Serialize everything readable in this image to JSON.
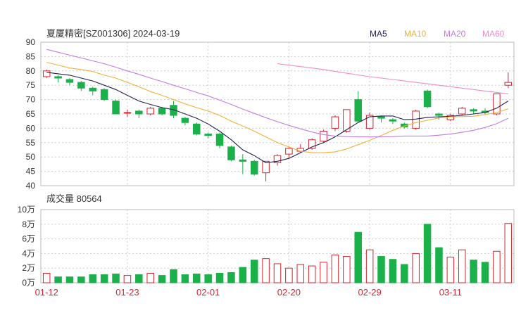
{
  "title": "夏厦精密[SZ001306] 2024-03-19",
  "legend": [
    {
      "label": "MA5",
      "color": "#1f2150"
    },
    {
      "label": "MA10",
      "color": "#f0b13c"
    },
    {
      "label": "MA20",
      "color": "#c07ee0"
    },
    {
      "label": "MA60",
      "color": "#f08cc8"
    }
  ],
  "colors": {
    "up": "#d4242f",
    "down": "#1ab04a",
    "grid": "#cccccc",
    "tick": "#333333",
    "date": "#d4242f"
  },
  "price_axis": {
    "ticks": [
      "90",
      "85",
      "80",
      "75",
      "70",
      "65",
      "60",
      "55",
      "50",
      "45",
      "40"
    ],
    "ylim": [
      40,
      90
    ]
  },
  "volume_axis": {
    "label": "成交量 80564",
    "ticks": [
      "10万",
      "8万",
      "6万",
      "4万",
      "2万",
      "0万"
    ],
    "ylim": [
      0,
      10
    ]
  },
  "x_axis": {
    "labels": [
      "01-12",
      "01-23",
      "02-01",
      "02-20",
      "02-29",
      "03-11"
    ],
    "label_index": [
      0,
      7,
      14,
      21,
      28,
      35
    ]
  },
  "chart_data": {
    "type": "candlestick",
    "title": "夏厦精密[SZ001306] 2024-03-19",
    "ohlc": [
      [
        78,
        80.5,
        77.5,
        80
      ],
      [
        78,
        78.5,
        76,
        77.5
      ],
      [
        77,
        77.5,
        75,
        76
      ],
      [
        76,
        76.5,
        73,
        74
      ],
      [
        74,
        74.5,
        71.5,
        73
      ],
      [
        73.5,
        74,
        69.5,
        70
      ],
      [
        69.5,
        70,
        65,
        65
      ],
      [
        65.5,
        66.5,
        64,
        65.5
      ],
      [
        66,
        66.5,
        63.5,
        65
      ],
      [
        65,
        67.5,
        64.5,
        67
      ],
      [
        67,
        67.5,
        64.5,
        65
      ],
      [
        68,
        69.5,
        63.5,
        64.5
      ],
      [
        63.5,
        64,
        61,
        62
      ],
      [
        61.5,
        62,
        57.5,
        58
      ],
      [
        58,
        58.5,
        56.5,
        57.5
      ],
      [
        58,
        58.5,
        53,
        54
      ],
      [
        53.5,
        54,
        48.5,
        49
      ],
      [
        49,
        51,
        44,
        48.5
      ],
      [
        48.5,
        49,
        43.5,
        44
      ],
      [
        44.5,
        48.5,
        41.5,
        48.5
      ],
      [
        48,
        51,
        47,
        50.5
      ],
      [
        51,
        53.5,
        49.5,
        53
      ],
      [
        52,
        54.5,
        51.5,
        53
      ],
      [
        53,
        56.5,
        52.5,
        56
      ],
      [
        55.5,
        59.5,
        55,
        59
      ],
      [
        60,
        64.5,
        59,
        64
      ],
      [
        59,
        66.5,
        58.5,
        66.5
      ],
      [
        70,
        73,
        62,
        62.5
      ],
      [
        60,
        65.5,
        59.5,
        64.5
      ],
      [
        64,
        64.5,
        62,
        63.5
      ],
      [
        63,
        63.5,
        61.5,
        62.5
      ],
      [
        61.5,
        62,
        60,
        60.5
      ],
      [
        60,
        66.5,
        59.5,
        66
      ],
      [
        73,
        73.5,
        67,
        67.5
      ],
      [
        65,
        65.5,
        63,
        64.5
      ],
      [
        63,
        65,
        62.5,
        64.5
      ],
      [
        65,
        67.5,
        64.5,
        67
      ],
      [
        66.5,
        67,
        65,
        66
      ],
      [
        66,
        67,
        65,
        65.5
      ],
      [
        65,
        72,
        64.5,
        72
      ],
      [
        75,
        79.5,
        74,
        76
      ]
    ],
    "volume": [
      1.3,
      0.8,
      0.8,
      0.8,
      1.1,
      1.1,
      1.2,
      1.0,
      1.1,
      1.3,
      1.0,
      1.8,
      1.1,
      1.2,
      1.1,
      1.3,
      1.4,
      2.1,
      3.1,
      3.3,
      2.6,
      2.0,
      2.5,
      2.3,
      2.8,
      3.8,
      3.6,
      6.9,
      4.5,
      3.6,
      3.2,
      2.5,
      4.0,
      8.0,
      4.8,
      3.5,
      4.5,
      3.1,
      2.8,
      4.3,
      8.1
    ],
    "ma5": [
      79.5,
      79,
      78.5,
      77.5,
      76.5,
      75,
      73.5,
      71.5,
      69.5,
      68.3,
      67.2,
      66.5,
      65,
      63.5,
      61.5,
      59,
      56,
      52.5,
      50.5,
      48,
      48.5,
      49.5,
      51.5,
      53.5,
      55,
      57,
      59.5,
      62,
      64,
      64.3,
      64.3,
      63,
      63.2,
      63.8,
      64,
      64.2,
      64.5,
      65,
      65.5,
      67,
      69.5
    ],
    "ma10": [
      83,
      82,
      81,
      80.5,
      79.8,
      78.5,
      77.5,
      76,
      74.5,
      72.8,
      71.5,
      70,
      68.5,
      67.2,
      66,
      64.5,
      62.5,
      60.8,
      59,
      57,
      55,
      53.5,
      52,
      51.5,
      51.5,
      51.8,
      52.8,
      54.3,
      55.8,
      57.5,
      59.3,
      60.8,
      62,
      62.8,
      63.6,
      64,
      64.1,
      64.2,
      64.8,
      65.5,
      66.8
    ],
    "ma20": [
      87.5,
      86.5,
      85.5,
      84.5,
      83.5,
      82.5,
      81.3,
      80,
      78.8,
      77.5,
      76.3,
      75,
      73.8,
      72.5,
      71.3,
      69.8,
      68.3,
      66.7,
      65.2,
      63.7,
      62.3,
      61,
      59.8,
      58.7,
      57.8,
      57.3,
      57.1,
      57,
      57,
      57,
      57.1,
      57.3,
      57.3,
      57.3,
      57.6,
      58,
      58.6,
      59.3,
      60.3,
      61.6,
      63.5
    ],
    "ma60": [
      null,
      null,
      null,
      null,
      null,
      null,
      null,
      null,
      null,
      null,
      null,
      null,
      null,
      null,
      null,
      null,
      null,
      null,
      null,
      null,
      82.5,
      82,
      81.5,
      81,
      80.5,
      79.8,
      79.2,
      78.6,
      78,
      77.5,
      77,
      76.5,
      76,
      75.5,
      75,
      74.5,
      74,
      73.5,
      73,
      72.5,
      72
    ]
  }
}
